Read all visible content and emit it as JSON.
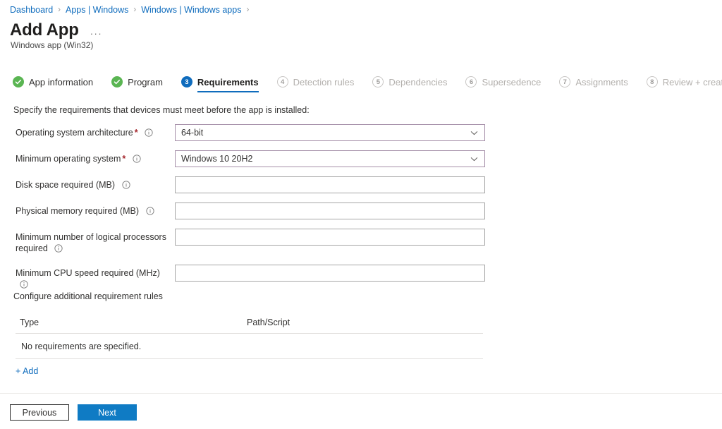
{
  "breadcrumb": {
    "separator": "›",
    "items": [
      {
        "label": "Dashboard"
      },
      {
        "label": "Apps | Windows"
      },
      {
        "label": "Windows | Windows apps"
      }
    ]
  },
  "header": {
    "title": "Add App",
    "more_menu": "···",
    "subtitle": "Windows app (Win32)"
  },
  "steps": [
    {
      "number": "1",
      "label": "App information",
      "state": "done"
    },
    {
      "number": "2",
      "label": "Program",
      "state": "done"
    },
    {
      "number": "3",
      "label": "Requirements",
      "state": "active"
    },
    {
      "number": "4",
      "label": "Detection rules",
      "state": "todo"
    },
    {
      "number": "5",
      "label": "Dependencies",
      "state": "todo"
    },
    {
      "number": "6",
      "label": "Supersedence",
      "state": "todo"
    },
    {
      "number": "7",
      "label": "Assignments",
      "state": "todo"
    },
    {
      "number": "8",
      "label": "Review + create",
      "state": "todo"
    }
  ],
  "main": {
    "intro": "Specify the requirements that devices must meet before the app is installed:",
    "fields": [
      {
        "label": "Operating system architecture",
        "required": true,
        "info": true,
        "type": "dropdown",
        "value": "64-bit"
      },
      {
        "label": "Minimum operating system",
        "required": true,
        "info": true,
        "type": "dropdown",
        "value": "Windows 10 20H2"
      },
      {
        "label": "Disk space required (MB)",
        "required": false,
        "info": true,
        "type": "text",
        "value": "",
        "placeholder": ""
      },
      {
        "label": "Physical memory required (MB)",
        "required": false,
        "info": true,
        "type": "text",
        "value": "",
        "placeholder": ""
      },
      {
        "label": "Minimum number of logical processors required",
        "required": false,
        "info": true,
        "type": "text",
        "value": "",
        "placeholder": ""
      },
      {
        "label": "Minimum CPU speed required (MHz)",
        "required": false,
        "info": true,
        "type": "text",
        "value": "",
        "placeholder": ""
      }
    ],
    "rules_section_label": "Configure additional requirement rules",
    "rules_table": {
      "columns": [
        "Type",
        "Path/Script"
      ],
      "empty_message": "No requirements are specified."
    },
    "add_link": "+ Add"
  },
  "footer": {
    "previous_label": "Previous",
    "next_label": "Next"
  },
  "colors": {
    "link": "#0f6cbd",
    "primary_button": "#0f7bc4",
    "step_done": "#5ab552",
    "step_active": "#0f6cbd",
    "required_star": "#a4262c",
    "dropdown_border": "#a58fa8",
    "input_border": "#a6a6a6"
  }
}
